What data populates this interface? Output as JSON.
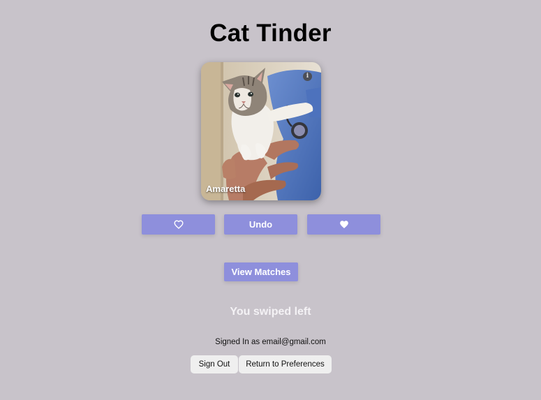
{
  "app": {
    "title": "Cat Tinder"
  },
  "card": {
    "cat_name": "Amaretta",
    "info_icon": "info-icon",
    "info_glyph": "i"
  },
  "actions": {
    "dislike_icon": "heart-outline-icon",
    "undo_label": "Undo",
    "like_icon": "heart-filled-icon"
  },
  "matches": {
    "label": "View Matches"
  },
  "status": {
    "message": "You swiped left"
  },
  "account": {
    "signed_in_text": "Signed In as email@gmail.com",
    "sign_out_label": "Sign Out",
    "preferences_label": "Return to Preferences"
  },
  "colors": {
    "background": "#c8c3ca",
    "accent_button": "#8e8fdc",
    "secondary_button": "#efefef"
  }
}
